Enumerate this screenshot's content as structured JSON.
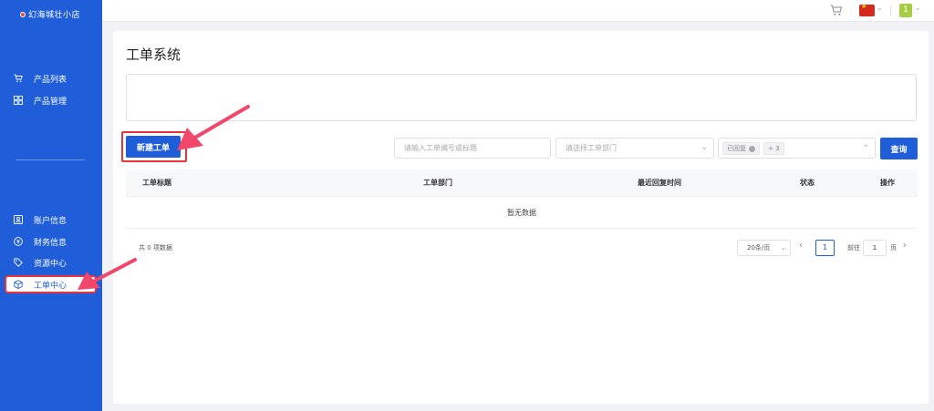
{
  "brand": {
    "logo_text": "幻海城壮小店"
  },
  "sidebar": {
    "items": [
      {
        "label": "产品列表",
        "icon": "cart-icon"
      },
      {
        "label": "产品管理",
        "icon": "grid-icon"
      },
      {
        "label": "账户信息",
        "icon": "id-card-icon"
      },
      {
        "label": "财务信息",
        "icon": "coin-icon"
      },
      {
        "label": "资源中心",
        "icon": "tag-icon"
      },
      {
        "label": "工单中心",
        "icon": "box-icon",
        "active": true
      }
    ]
  },
  "topbar": {
    "user_badge": "1"
  },
  "main": {
    "title": "工单系统",
    "new_ticket_label": "新建工单",
    "search_placeholder": "请输入工单编号或标题",
    "dept_placeholder": "请选择工单部门",
    "status_tag": "已回复",
    "status_more": "+ 3",
    "query_label": "查询",
    "columns": [
      "工单标题",
      "工单部门",
      "最近回复时间",
      "状态",
      "操作"
    ],
    "empty_text": "暂无数据",
    "pagination": {
      "total_text": "共 0 项数据",
      "page_size": "20条/页",
      "current_page": "1",
      "goto_label": "前往",
      "goto_value": "1",
      "page_unit": "页"
    }
  },
  "colors": {
    "primary": "#1f5ed8",
    "highlight": "#e8333c",
    "arrow": "#f0476a"
  }
}
